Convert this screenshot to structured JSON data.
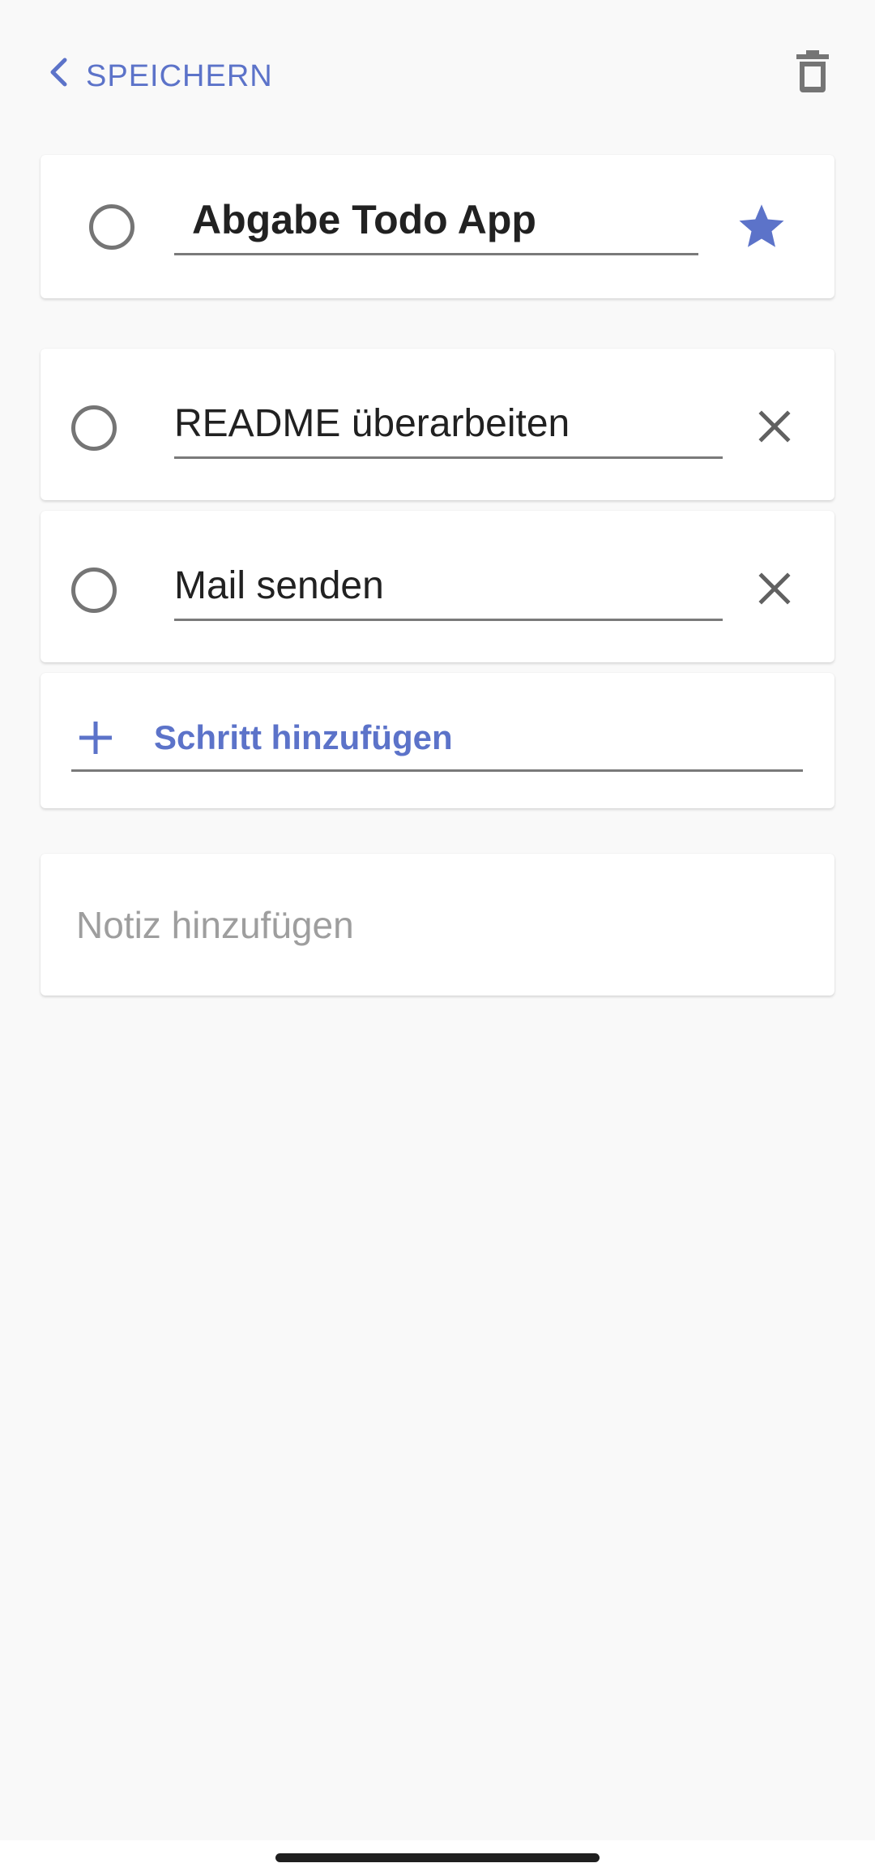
{
  "colors": {
    "accent": "#5c73c9",
    "background": "#f9f9f9",
    "card": "#ffffff",
    "icon_gray": "#757575",
    "placeholder": "#9e9e9e"
  },
  "header": {
    "back_label": "SPEICHERN",
    "back_icon": "chevron-left-icon",
    "delete_icon": "trash-icon"
  },
  "task": {
    "title": "Abgabe Todo App",
    "completed": false,
    "starred": true,
    "star_icon": "star-icon"
  },
  "steps": [
    {
      "label": "README überarbeiten",
      "completed": false,
      "remove_icon": "close-icon"
    },
    {
      "label": "Mail senden",
      "completed": false,
      "remove_icon": "close-icon"
    }
  ],
  "add_step": {
    "label": "Schritt hinzufügen",
    "icon": "plus-icon"
  },
  "note": {
    "placeholder": "Notiz hinzufügen"
  }
}
